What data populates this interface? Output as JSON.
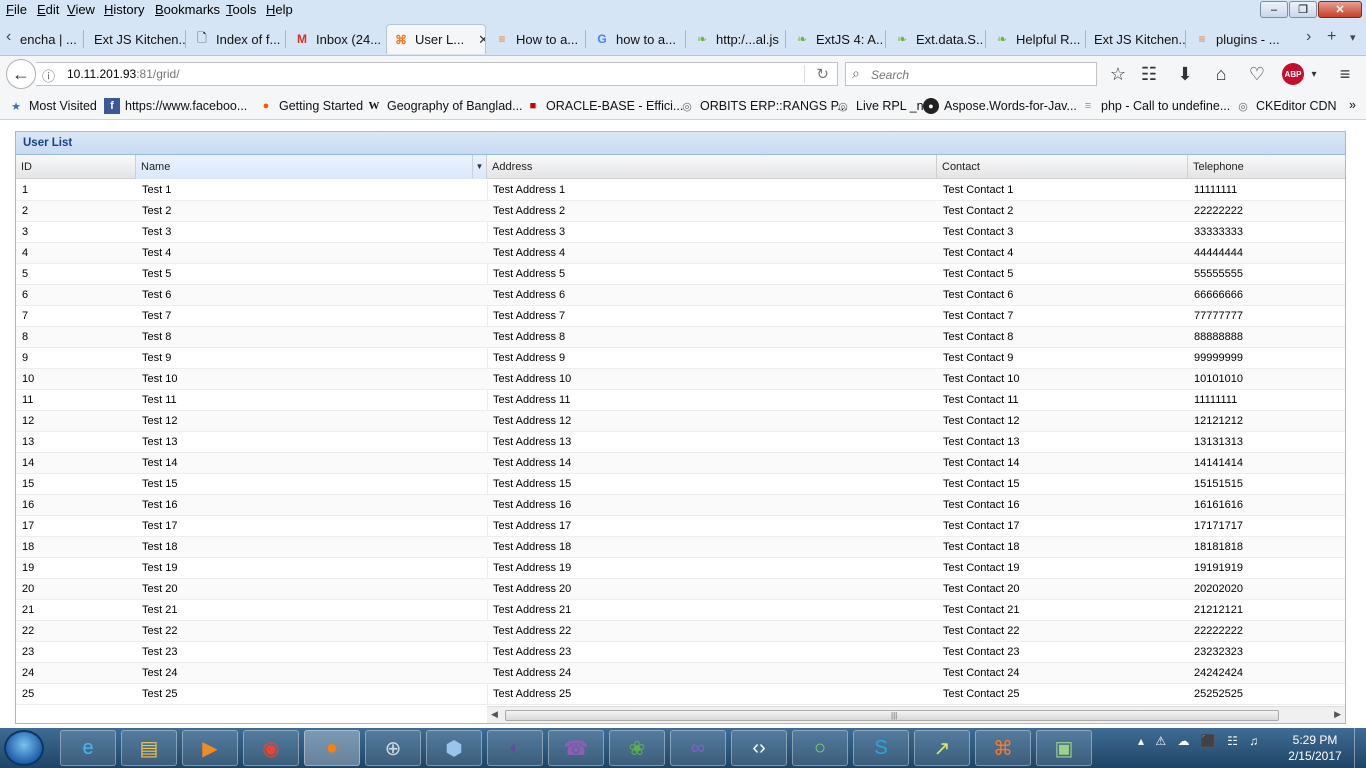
{
  "menubar": {
    "items": [
      "File",
      "Edit",
      "View",
      "History",
      "Bookmarks",
      "Tools",
      "Help"
    ],
    "window_controls": [
      "minimize-icon",
      "restore-icon",
      "close-icon"
    ]
  },
  "tabs": [
    {
      "label": "encha | ...",
      "icon": "sencha-icon"
    },
    {
      "label": "Ext JS Kitchen...",
      "icon": "none"
    },
    {
      "label": "Index of f...",
      "icon": "page-icon"
    },
    {
      "label": "Inbox (24...",
      "icon": "gmail-icon"
    },
    {
      "label": "User L...",
      "icon": "xampp-icon",
      "active": true
    },
    {
      "label": "How to a...",
      "icon": "stackoverflow-icon"
    },
    {
      "label": "how to a...",
      "icon": "google-icon"
    },
    {
      "label": "http:/...al.js",
      "icon": "sencha-leaf-icon"
    },
    {
      "label": "ExtJS 4: A...",
      "icon": "sencha-leaf-icon"
    },
    {
      "label": "Ext.data.S...",
      "icon": "sencha-leaf-icon"
    },
    {
      "label": "Helpful R...",
      "icon": "sencha-leaf-icon"
    },
    {
      "label": "Ext JS Kitchen...",
      "icon": "none"
    },
    {
      "label": "plugins - ...",
      "icon": "stackoverflow-icon"
    }
  ],
  "navbar": {
    "url_host": "10.11.201.93",
    "url_rest": ":81/grid/",
    "search_placeholder": "Search",
    "adblock_label": "ABP"
  },
  "bookmarks": [
    {
      "label": "Most Visited",
      "icon": "most-visited-icon"
    },
    {
      "label": "https://www.faceboo...",
      "icon": "facebook-icon"
    },
    {
      "label": "Getting Started",
      "icon": "firefox-icon"
    },
    {
      "label": "Geography of Banglad...",
      "icon": "wikipedia-icon"
    },
    {
      "label": "ORACLE-BASE - Effici...",
      "icon": "oracle-base-icon"
    },
    {
      "label": "ORBITS ERP::RANGS P...",
      "icon": "globe-icon"
    },
    {
      "label": "Live RPL _n",
      "icon": "globe-icon"
    },
    {
      "label": "Aspose.Words-for-Jav...",
      "icon": "github-icon"
    },
    {
      "label": "php - Call to undefine...",
      "icon": "stackoverflow-icon"
    },
    {
      "label": "CKEditor CDN",
      "icon": "globe-icon"
    }
  ],
  "grid": {
    "title": "User List",
    "columns": [
      "ID",
      "Name",
      "Address",
      "Contact",
      "Telephone"
    ],
    "rows": [
      [
        "1",
        "Test 1",
        "Test Address 1",
        "Test Contact 1",
        "11111111"
      ],
      [
        "2",
        "Test 2",
        "Test Address 2",
        "Test Contact 2",
        "22222222"
      ],
      [
        "3",
        "Test 3",
        "Test Address 3",
        "Test Contact 3",
        "33333333"
      ],
      [
        "4",
        "Test 4",
        "Test Address 4",
        "Test Contact 4",
        "44444444"
      ],
      [
        "5",
        "Test 5",
        "Test Address 5",
        "Test Contact 5",
        "55555555"
      ],
      [
        "6",
        "Test 6",
        "Test Address 6",
        "Test Contact 6",
        "66666666"
      ],
      [
        "7",
        "Test 7",
        "Test Address 7",
        "Test Contact 7",
        "77777777"
      ],
      [
        "8",
        "Test 8",
        "Test Address 8",
        "Test Contact 8",
        "88888888"
      ],
      [
        "9",
        "Test 9",
        "Test Address 9",
        "Test Contact 9",
        "99999999"
      ],
      [
        "10",
        "Test 10",
        "Test Address 10",
        "Test Contact 10",
        "10101010"
      ],
      [
        "11",
        "Test 11",
        "Test Address 11",
        "Test Contact 11",
        "11111111"
      ],
      [
        "12",
        "Test 12",
        "Test Address 12",
        "Test Contact 12",
        "12121212"
      ],
      [
        "13",
        "Test 13",
        "Test Address 13",
        "Test Contact 13",
        "13131313"
      ],
      [
        "14",
        "Test 14",
        "Test Address 14",
        "Test Contact 14",
        "14141414"
      ],
      [
        "15",
        "Test 15",
        "Test Address 15",
        "Test Contact 15",
        "15151515"
      ],
      [
        "16",
        "Test 16",
        "Test Address 16",
        "Test Contact 16",
        "16161616"
      ],
      [
        "17",
        "Test 17",
        "Test Address 17",
        "Test Contact 17",
        "17171717"
      ],
      [
        "18",
        "Test 18",
        "Test Address 18",
        "Test Contact 18",
        "18181818"
      ],
      [
        "19",
        "Test 19",
        "Test Address 19",
        "Test Contact 19",
        "19191919"
      ],
      [
        "20",
        "Test 20",
        "Test Address 20",
        "Test Contact 20",
        "20202020"
      ],
      [
        "21",
        "Test 21",
        "Test Address 21",
        "Test Contact 21",
        "21212121"
      ],
      [
        "22",
        "Test 22",
        "Test Address 22",
        "Test Contact 22",
        "22222222"
      ],
      [
        "23",
        "Test 23",
        "Test Address 23",
        "Test Contact 23",
        "23232323"
      ],
      [
        "24",
        "Test 24",
        "Test Address 24",
        "Test Contact 24",
        "24242424"
      ],
      [
        "25",
        "Test 25",
        "Test Address 25",
        "Test Contact 25",
        "25252525"
      ]
    ]
  },
  "taskbar": {
    "apps": [
      "internet-explorer-icon",
      "file-explorer-icon",
      "media-player-icon",
      "chrome-icon",
      "firefox-icon",
      "safari-icon",
      "virtualbox-icon",
      "eclipse-icon",
      "viber-icon",
      "frog-app-icon",
      "visual-studio-icon",
      "vscode-icon",
      "ezoom-icon",
      "skype-icon",
      "chart-app-icon",
      "xampp-icon",
      "remote-desktop-icon"
    ],
    "time": "5:29 PM",
    "date": "2/15/2017"
  }
}
